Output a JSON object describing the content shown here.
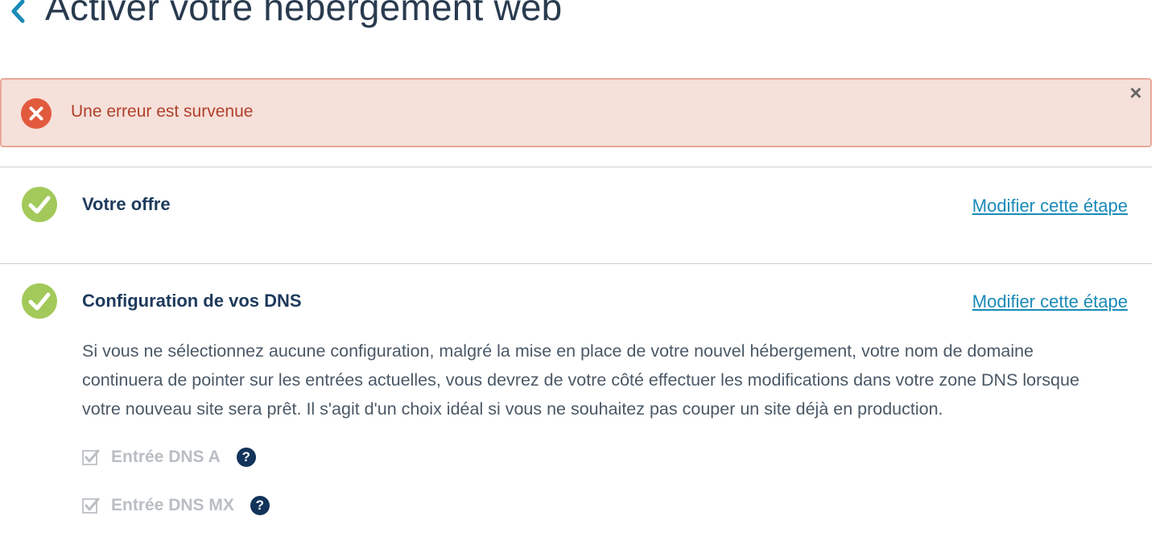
{
  "header": {
    "title": "Activer votre hébergement web"
  },
  "alert": {
    "message": "Une erreur est survenue",
    "close_label": "×"
  },
  "steps": [
    {
      "title": "Votre offre",
      "edit_link": "Modifier cette étape"
    },
    {
      "title": "Configuration de vos DNS",
      "edit_link": "Modifier cette étape",
      "description": "Si vous ne sélectionnez aucune configuration, malgré la mise en place de votre nouvel hébergement, votre nom de domaine continuera de pointer sur les entrées actuelles, vous devrez de votre côté effectuer les modifications dans votre zone DNS lorsque votre nouveau site sera prêt. Il s'agit d'un choix idéal si vous ne souhaitez pas couper un site déjà en production.",
      "options": [
        {
          "label": "Entrée DNS A",
          "checked": true,
          "disabled": true,
          "help": "?"
        },
        {
          "label": "Entrée DNS MX",
          "checked": true,
          "disabled": true,
          "help": "?"
        }
      ]
    }
  ],
  "colors": {
    "accent": "#1a8ab8",
    "success": "#a2c95a",
    "error": "#e25a3d",
    "error_bg": "#f6e0da",
    "heading": "#1d3a5c"
  },
  "icons": {
    "back": "chevron-left-icon",
    "error": "error-circle-icon",
    "close": "close-icon",
    "check": "check-circle-icon",
    "checkbox": "checkbox-checked-icon",
    "help": "help-icon"
  }
}
